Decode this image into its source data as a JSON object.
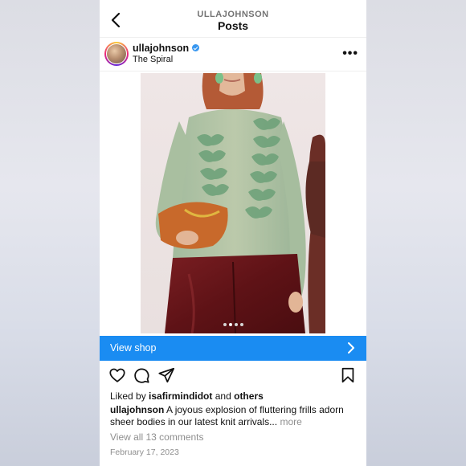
{
  "header": {
    "subtitle": "ULLAJOHNSON",
    "title": "Posts"
  },
  "post": {
    "username": "ullajohnson",
    "verified": true,
    "location": "The Spiral",
    "carousel": {
      "count": 4,
      "active_index": 1
    },
    "shop_label": "View shop",
    "likes": {
      "prefix": "Liked by",
      "user": "isafirmindidot",
      "connector": "and",
      "others": "others"
    },
    "caption": {
      "user": "ullajohnson",
      "text": "A joyous explosion of fluttering frills adorn sheer bodies in our latest knit arrivals...",
      "more": "more"
    },
    "comments_link": "View all 13 comments",
    "date": "February 17, 2023"
  },
  "icons": {
    "back": "chevron-left-icon",
    "more": "ellipsis-icon",
    "like": "heart-icon",
    "comment": "comment-icon",
    "share": "send-icon",
    "save": "bookmark-icon",
    "shop": "chevron-right-icon"
  },
  "colors": {
    "accent": "#1a8cf2",
    "verified": "#3897f0",
    "muted_text": "#8e8e8e"
  }
}
